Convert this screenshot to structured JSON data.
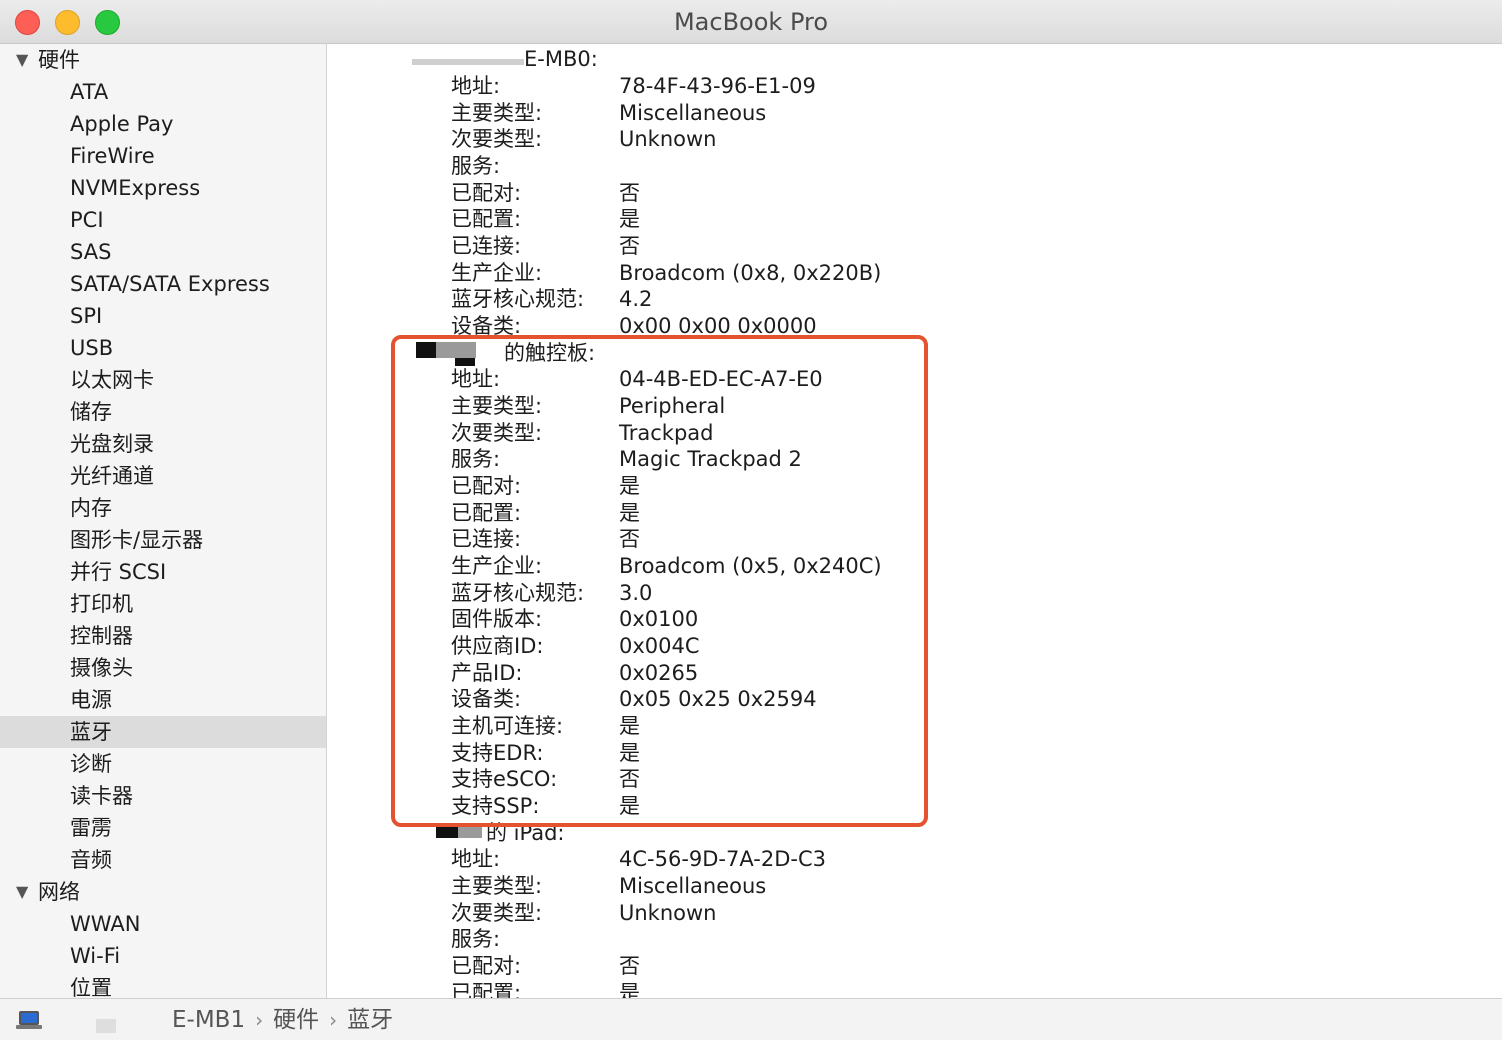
{
  "window": {
    "title": "MacBook Pro"
  },
  "sidebar": {
    "groups": [
      {
        "label": "硬件",
        "items": [
          "ATA",
          "Apple Pay",
          "FireWire",
          "NVMExpress",
          "PCI",
          "SAS",
          "SATA/SATA Express",
          "SPI",
          "USB",
          "以太网卡",
          "储存",
          "光盘刻录",
          "光纤通道",
          "内存",
          "图形卡/显示器",
          "并行 SCSI",
          "打印机",
          "控制器",
          "摄像头",
          "电源",
          "蓝牙",
          "诊断",
          "读卡器",
          "雷雳",
          "音频"
        ]
      },
      {
        "label": "网络",
        "items": [
          "WWAN",
          "Wi-Fi",
          "位置"
        ]
      }
    ],
    "selected": "蓝牙"
  },
  "content": {
    "devices": [
      {
        "title": "E-MB0:",
        "fields": [
          {
            "key": "地址:",
            "value": "78-4F-43-96-E1-09"
          },
          {
            "key": "主要类型:",
            "value": "Miscellaneous"
          },
          {
            "key": "次要类型:",
            "value": "Unknown"
          },
          {
            "key": "服务:",
            "value": ""
          },
          {
            "key": "已配对:",
            "value": "否"
          },
          {
            "key": "已配置:",
            "value": "是"
          },
          {
            "key": "已连接:",
            "value": "否"
          },
          {
            "key": "生产企业:",
            "value": "Broadcom (0x8, 0x220B)"
          },
          {
            "key": "蓝牙核心规范:",
            "value": "4.2"
          },
          {
            "key": "设备类:",
            "value": "0x00 0x00 0x0000"
          }
        ]
      },
      {
        "title": "的触控板:",
        "fields": [
          {
            "key": "地址:",
            "value": "04-4B-ED-EC-A7-E0"
          },
          {
            "key": "主要类型:",
            "value": "Peripheral"
          },
          {
            "key": "次要类型:",
            "value": "Trackpad"
          },
          {
            "key": "服务:",
            "value": "Magic Trackpad 2"
          },
          {
            "key": "已配对:",
            "value": "是"
          },
          {
            "key": "已配置:",
            "value": "是"
          },
          {
            "key": "已连接:",
            "value": "否"
          },
          {
            "key": "生产企业:",
            "value": "Broadcom (0x5, 0x240C)"
          },
          {
            "key": "蓝牙核心规范:",
            "value": "3.0"
          },
          {
            "key": "固件版本:",
            "value": "0x0100"
          },
          {
            "key": "供应商ID:",
            "value": "0x004C"
          },
          {
            "key": "产品ID:",
            "value": "0x0265"
          },
          {
            "key": "设备类:",
            "value": "0x05 0x25 0x2594"
          },
          {
            "key": "主机可连接:",
            "value": "是"
          },
          {
            "key": "支持EDR:",
            "value": "是"
          },
          {
            "key": "支持eSCO:",
            "value": "否"
          },
          {
            "key": "支持SSP:",
            "value": "是"
          }
        ]
      },
      {
        "title": "的 iPad:",
        "fields": [
          {
            "key": "地址:",
            "value": "4C-56-9D-7A-2D-C3"
          },
          {
            "key": "主要类型:",
            "value": "Miscellaneous"
          },
          {
            "key": "次要类型:",
            "value": "Unknown"
          },
          {
            "key": "服务:",
            "value": ""
          },
          {
            "key": "已配对:",
            "value": "否"
          },
          {
            "key": "已配置:",
            "value": "是"
          }
        ]
      }
    ]
  },
  "pathbar": {
    "crumbs": [
      "E-MB1",
      "硬件",
      "蓝牙"
    ],
    "separator": "›"
  },
  "colors": {
    "highlight": "#e4532f",
    "close": "#fd5f57",
    "minimize": "#fdbc2e",
    "zoom": "#28c840",
    "selected_row": "#dcdcdc"
  }
}
